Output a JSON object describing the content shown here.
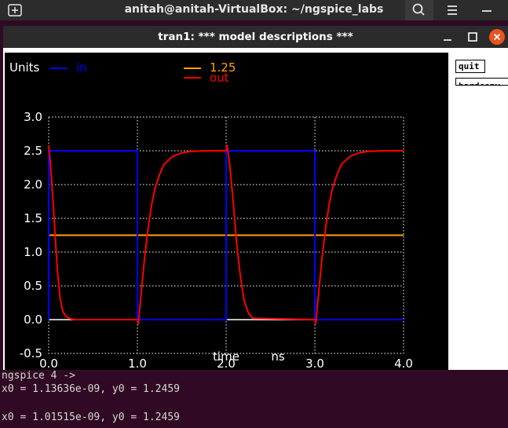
{
  "terminal_window": {
    "title": "anitah@anitah-VirtualBox: ~/ngspice_labs",
    "icons": [
      "new-tab-icon",
      "search-icon",
      "hamburger-menu-icon",
      "minimize-icon"
    ]
  },
  "plot_window": {
    "title": "tran1: *** model descriptions ***",
    "buttons": {
      "quit": "quit",
      "hardcopy": "hardcopy"
    }
  },
  "terminal": {
    "lines": [
      "ngspice 4 ->",
      "x0 = 1.13636e-09, y0 = 1.2459",
      "",
      "x0 = 1.01515e-09, y0 = 1.2459"
    ]
  },
  "colors": {
    "in": "#0000ff",
    "out": "#ff0000",
    "ref": "#ffa500",
    "background": "#000000"
  },
  "chart_data": {
    "type": "line",
    "title": "",
    "units_label": "Units",
    "xlabel": "time",
    "xunit": "ns",
    "xlim": [
      0,
      4
    ],
    "ylim": [
      -0.5,
      3.0
    ],
    "xticks": [
      "0.0",
      "1.0",
      "2.0",
      "3.0",
      "4.0"
    ],
    "yticks": [
      "-0.5",
      "0.0",
      "0.5",
      "1.0",
      "1.5",
      "2.0",
      "2.5",
      "3.0"
    ],
    "grid": true,
    "legend": [
      {
        "name": "in",
        "color": "#0000ff"
      },
      {
        "name": "1.25",
        "color": "#ffa500"
      },
      {
        "name": "out",
        "color": "#ff0000"
      }
    ],
    "series": [
      {
        "name": "in",
        "x": [
          0,
          0.0,
          1.0,
          1.0,
          2.0,
          2.0,
          3.0,
          3.0,
          4.0
        ],
        "y": [
          0,
          2.5,
          2.5,
          0,
          0,
          2.5,
          2.5,
          0,
          0
        ]
      },
      {
        "name": "1.25",
        "x": [
          0,
          4.0
        ],
        "y": [
          1.25,
          1.25
        ]
      },
      {
        "name": "out",
        "x": [
          0.0,
          0.02,
          0.05,
          0.08,
          0.1,
          0.13,
          0.16,
          0.2,
          0.25,
          0.3,
          1.0,
          1.01,
          1.04,
          1.08,
          1.12,
          1.16,
          1.2,
          1.25,
          1.3,
          1.4,
          1.5,
          1.6,
          1.75,
          2.0,
          2.01,
          2.04,
          2.08,
          2.12,
          2.16,
          2.2,
          2.25,
          2.3,
          3.0,
          3.01,
          3.04,
          3.08,
          3.12,
          3.16,
          3.2,
          3.25,
          3.3,
          3.4,
          3.5,
          3.6,
          3.75,
          4.0
        ],
        "y": [
          2.58,
          2.3,
          1.75,
          1.1,
          0.7,
          0.3,
          0.12,
          0.04,
          0.01,
          0.0,
          0.0,
          -0.06,
          0.35,
          0.9,
          1.35,
          1.7,
          1.95,
          2.15,
          2.3,
          2.42,
          2.47,
          2.49,
          2.5,
          2.5,
          2.58,
          2.3,
          1.75,
          1.1,
          0.65,
          0.3,
          0.1,
          0.02,
          0.0,
          -0.06,
          0.35,
          0.9,
          1.35,
          1.7,
          1.95,
          2.15,
          2.3,
          2.42,
          2.47,
          2.49,
          2.5,
          2.5
        ]
      }
    ]
  }
}
